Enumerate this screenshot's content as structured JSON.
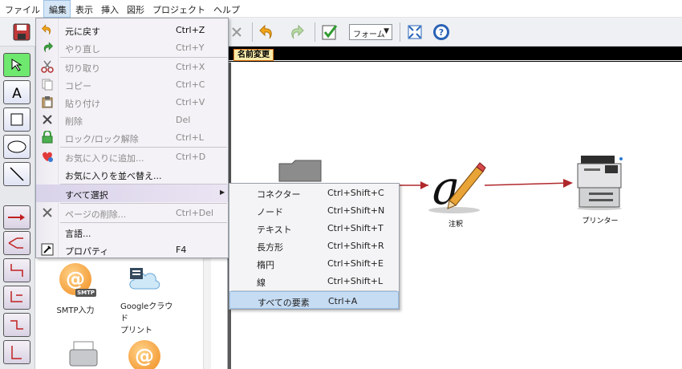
{
  "menubar": {
    "items": [
      {
        "label": "ファイル",
        "active": false
      },
      {
        "label": "編集",
        "active": true
      },
      {
        "label": "表示",
        "active": false
      },
      {
        "label": "挿入",
        "active": false
      },
      {
        "label": "図形",
        "active": false
      },
      {
        "label": "プロジェクト",
        "active": false
      },
      {
        "label": "ヘルプ",
        "active": false
      }
    ]
  },
  "toolbar": {
    "form_select": "フォーム"
  },
  "canvas": {
    "tab_label": "名前変更",
    "nodes": {
      "annotation": "注釈",
      "printer": "プリンター"
    },
    "connector_color": "#b0282c"
  },
  "library": {
    "items": [
      {
        "label": "SMTP入力"
      },
      {
        "label": "Googleクラウド\nプリント"
      }
    ]
  },
  "edit_menu": {
    "items": [
      {
        "label": "元に戻す",
        "shortcut": "Ctrl+Z",
        "enabled": true,
        "icon": "undo-icon"
      },
      {
        "label": "やり直し",
        "shortcut": "Ctrl+Y",
        "enabled": false,
        "icon": "redo-icon"
      },
      {
        "label": "切り取り",
        "shortcut": "Ctrl+X",
        "enabled": false,
        "icon": "scissors-icon"
      },
      {
        "label": "コピー",
        "shortcut": "Ctrl+C",
        "enabled": false,
        "icon": "copy-icon"
      },
      {
        "label": "貼り付け",
        "shortcut": "Ctrl+V",
        "enabled": false,
        "icon": "paste-icon"
      },
      {
        "label": "削除",
        "shortcut": "Del",
        "enabled": false,
        "icon": "delete-icon"
      },
      {
        "label": "ロック/ロック解除",
        "shortcut": "Ctrl+L",
        "enabled": false,
        "icon": "lock-icon"
      },
      {
        "label": "お気に入りに追加...",
        "shortcut": "Ctrl+D",
        "enabled": false,
        "icon": "heart-add-icon"
      },
      {
        "label": "お気に入りを並べ替え...",
        "shortcut": "",
        "enabled": true,
        "icon": ""
      },
      {
        "label": "すべて選択",
        "shortcut": "",
        "enabled": true,
        "icon": "",
        "submenu": true
      },
      {
        "label": "ページの削除...",
        "shortcut": "Ctrl+Del",
        "enabled": false,
        "icon": "delete-page-icon"
      },
      {
        "label": "言語...",
        "shortcut": "",
        "enabled": true,
        "icon": ""
      },
      {
        "label": "プロパティ",
        "shortcut": "F4",
        "enabled": true,
        "icon": "properties-icon"
      }
    ]
  },
  "select_all_submenu": {
    "items": [
      {
        "label": "コネクター",
        "shortcut": "Ctrl+Shift+C"
      },
      {
        "label": "ノード",
        "shortcut": "Ctrl+Shift+N"
      },
      {
        "label": "テキスト",
        "shortcut": "Ctrl+Shift+T"
      },
      {
        "label": "長方形",
        "shortcut": "Ctrl+Shift+R"
      },
      {
        "label": "楕円",
        "shortcut": "Ctrl+Shift+E"
      },
      {
        "label": "線",
        "shortcut": "Ctrl+Shift+L"
      },
      {
        "label": "すべての要素",
        "shortcut": "Ctrl+A"
      }
    ]
  }
}
